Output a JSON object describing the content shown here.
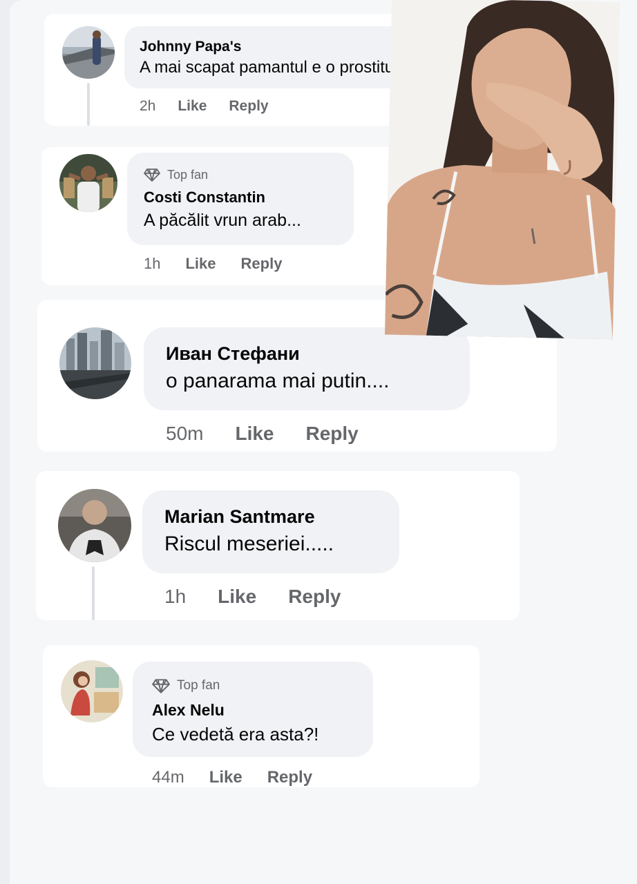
{
  "comments": [
    {
      "name": "Johnny Papa's",
      "text": "A mai scapat pamantul e o prostituata",
      "time": "2h",
      "like": "Like",
      "reply": "Reply",
      "top_fan": null
    },
    {
      "name": "Costi Constantin",
      "text": "A păcălit vrun arab...",
      "time": "1h",
      "like": "Like",
      "reply": "Reply",
      "top_fan": "Top fan"
    },
    {
      "name": "Иван Стефани",
      "text": "o panarama mai putin....",
      "time": "50m",
      "like": "Like",
      "reply": "Reply",
      "top_fan": null
    },
    {
      "name": "Marian Santmare",
      "text": "Riscul meseriei.....",
      "time": "1h",
      "like": "Like",
      "reply": "Reply",
      "top_fan": null
    },
    {
      "name": "Alex Nelu",
      "text": "Ce vedetă era asta?!",
      "time": "44m",
      "like": "Like",
      "reply": "Reply",
      "top_fan": "Top fan"
    }
  ],
  "icons": {
    "top_fan_badge": "diamond-icon"
  },
  "colors": {
    "bubble": "#f0f2f5",
    "meta_text": "#65676b",
    "name_text": "#050505",
    "card": "#ffffff"
  }
}
